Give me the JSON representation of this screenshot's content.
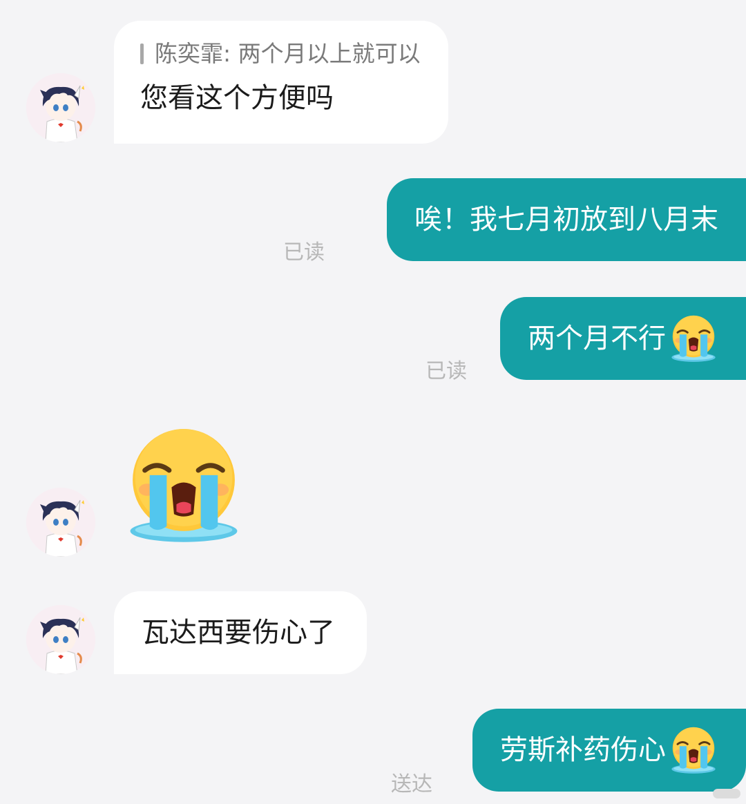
{
  "conversation": {
    "messages": [
      {
        "direction": "in",
        "quote_label": "陈奕霏: 两个月以上就可以",
        "text": "您看这个方便吗"
      },
      {
        "direction": "out",
        "text": "唉！我七月初放到八月末",
        "status": "已读"
      },
      {
        "direction": "out",
        "text": "两个月不行",
        "emoji": "loudly-crying-face-icon",
        "status": "已读"
      },
      {
        "direction": "in",
        "emoji": "loudly-crying-face-icon"
      },
      {
        "direction": "in",
        "text": "瓦达西要伤心了"
      },
      {
        "direction": "out",
        "text": "劳斯补药伤心",
        "emoji": "loudly-crying-face-icon",
        "status": "送达"
      }
    ]
  },
  "colors": {
    "background": "#f4f4f6",
    "incoming_bubble": "#ffffff",
    "outgoing_bubble": "#15a0a5",
    "status_text": "#b7b7b7"
  }
}
